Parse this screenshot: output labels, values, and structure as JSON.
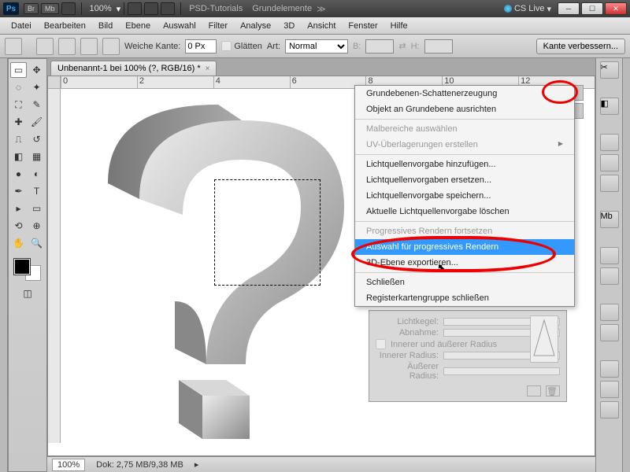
{
  "titlebar": {
    "ps": "Ps",
    "br": "Br",
    "mb": "Mb",
    "zoom": "100%",
    "link1": "PSD-Tutorials",
    "link2": "Grundelemente",
    "cslive": "CS Live"
  },
  "menu": {
    "items": [
      "Datei",
      "Bearbeiten",
      "Bild",
      "Ebene",
      "Auswahl",
      "Filter",
      "Analyse",
      "3D",
      "Ansicht",
      "Fenster",
      "Hilfe"
    ]
  },
  "options": {
    "weiche_kante_lbl": "Weiche Kante:",
    "weiche_kante_val": "0 Px",
    "glaetten": "Glätten",
    "art_lbl": "Art:",
    "art_val": "Normal",
    "b_lbl": "B:",
    "h_lbl": "H:",
    "refine": "Kante verbessern..."
  },
  "tab": {
    "title": "Unbenannt-1 bei 100% (?, RGB/16) *"
  },
  "ruler": [
    "0",
    "2",
    "4",
    "6",
    "8",
    "10",
    "12"
  ],
  "status": {
    "zoom": "100%",
    "doc": "Dok: 2,75 MB/9,38 MB"
  },
  "flyout": {
    "items": [
      {
        "label": "Grundebenen-Schattenerzeugung",
        "type": "n"
      },
      {
        "label": "Objekt an Grundebene ausrichten",
        "type": "n"
      },
      {
        "type": "sep"
      },
      {
        "label": "Malbereiche auswählen",
        "type": "dis"
      },
      {
        "label": "UV-Überlagerungen erstellen",
        "type": "sub dis"
      },
      {
        "type": "sep"
      },
      {
        "label": "Lichtquellenvorgabe hinzufügen...",
        "type": "n"
      },
      {
        "label": "Lichtquellenvorgaben ersetzen...",
        "type": "n"
      },
      {
        "label": "Lichtquellenvorgabe speichern...",
        "type": "n"
      },
      {
        "label": "Aktuelle Lichtquellenvorgabe löschen",
        "type": "n"
      },
      {
        "type": "sep"
      },
      {
        "label": "Progressives Rendern fortsetzen",
        "type": "dis"
      },
      {
        "label": "Auswahl für progressives Rendern",
        "type": "sel"
      },
      {
        "label": "3D-Ebene exportieren...",
        "type": "n"
      },
      {
        "type": "sep"
      },
      {
        "label": "Schließen",
        "type": "n"
      },
      {
        "label": "Registerkartengruppe schließen",
        "type": "n"
      }
    ]
  },
  "panel": {
    "lichtkegel": "Lichtkegel:",
    "abnahme": "Abnahme:",
    "innerer_check": "Innerer und äußerer Radius",
    "innerer_r": "Innerer Radius:",
    "aeusserer_r": "Äußerer Radius:"
  }
}
